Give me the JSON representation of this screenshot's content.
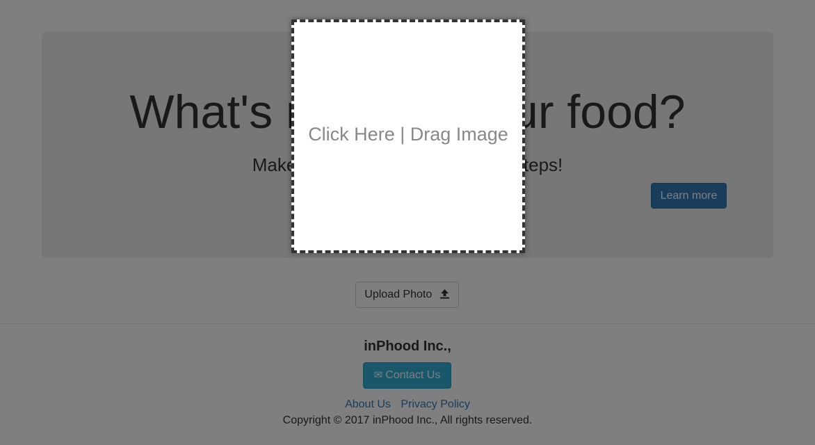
{
  "hero": {
    "title": "What's really in your food?",
    "subtitle": "Make it simple in just three easy steps!",
    "learn_more_label": "Learn more"
  },
  "upload": {
    "label": "Upload Photo",
    "icon": "upload-icon"
  },
  "footer": {
    "company": "inPhood Inc.,",
    "contact_label": "Contact Us",
    "contact_icon": "envelope-icon",
    "links": [
      {
        "label": "About Us"
      },
      {
        "label": "Privacy Policy"
      }
    ],
    "copyright": "Copyright © 2017 inPhood Inc., All rights reserved."
  },
  "dropzone": {
    "label": "Click Here | Drag Image"
  },
  "colors": {
    "primary": "#337ab7",
    "info": "#31b0d5",
    "overlay": "rgba(0,0,0,0.5)"
  }
}
